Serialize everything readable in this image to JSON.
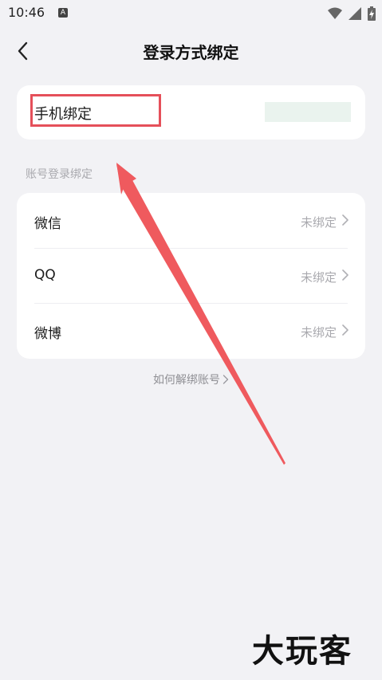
{
  "status_bar": {
    "time": "10:46",
    "badge": "A"
  },
  "header": {
    "title": "登录方式绑定"
  },
  "phone_card": {
    "label": "手机绑定"
  },
  "section": {
    "label": "账号登录绑定"
  },
  "accounts": [
    {
      "name": "微信",
      "status": "未绑定"
    },
    {
      "name": "QQ",
      "status": "未绑定"
    },
    {
      "name": "微博",
      "status": "未绑定"
    }
  ],
  "help": {
    "label": "如何解绑账号"
  },
  "watermark": {
    "text": "大玩客"
  },
  "colors": {
    "highlight": "#e5505a",
    "arrow": "#ef5a5e",
    "background": "#f2f2f5"
  }
}
